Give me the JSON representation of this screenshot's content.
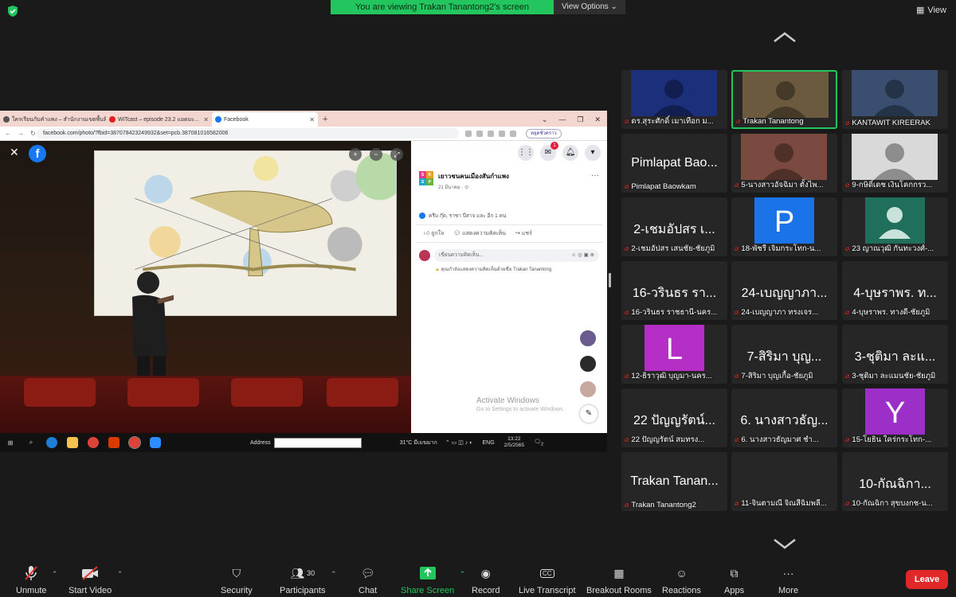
{
  "banner": {
    "viewing": "You are viewing Trakan Tanantong2's screen",
    "view_options": "View Options ⌄",
    "view": "View"
  },
  "browser": {
    "tabs": [
      {
        "title": "ใครเรียนกับคำแพง – สำนักงานเขตพื้นที่...",
        "color": "#555"
      },
      {
        "title": "WiTcast – episode 23.2 แอดมะ...",
        "color": "#e02020"
      },
      {
        "title": "Facebook",
        "color": "#1877f2"
      }
    ],
    "url": "facebook.com/photo/?fbid=387078423249932&set=pcb.387081016582006",
    "profile_chip": "หยุดชั่วคราว"
  },
  "facebook": {
    "page_name": "เยาวชนคนเมืองสันกำแพง",
    "avatar_letters": [
      "S",
      "K",
      "S",
      "P"
    ],
    "date": "21 มีนาคม · ⊙",
    "reactions": "ครีม กุ๊ด, ราชา ปีสาจ และ อีก 1 คน",
    "like": "ถูกใจ",
    "comment": "แสดงความคิดเห็น",
    "share": "แชร์",
    "comment_placeholder": "เขียนความคิดเห็น...",
    "warning": "คุณกำลังแสดงความคิดเห็นด้วยชื่อ Trakan Tanantong",
    "activate_title": "Activate Windows",
    "activate_sub": "Go to Settings to activate Windows.",
    "messenger_badge": "1"
  },
  "taskbar": {
    "address_label": "Address",
    "weather": "31°C มีเมฆมาก",
    "lang": "ENG",
    "time": "13:22",
    "date": "2/5/2565",
    "notify": "2"
  },
  "gallery": [
    {
      "big": "",
      "cap": "ดร.สุระศักดิ์ เมาเทือก ม...",
      "type": "video",
      "bg": "#1c2f7a"
    },
    {
      "big": "",
      "cap": "Trakan Tanantong",
      "type": "video",
      "bg": "#6b5a3e",
      "speaking": true
    },
    {
      "big": "",
      "cap": "KANTAWIT KIREERAK",
      "type": "video",
      "bg": "#3a4f70"
    },
    {
      "big": "Pimlapat Bao...",
      "cap": "Pimlapat Baowkam",
      "type": "name"
    },
    {
      "big": "",
      "cap": "5-นางสาวอัจฉิมา ตั้งไพ...",
      "type": "video",
      "bg": "#7a4a40"
    },
    {
      "big": "",
      "cap": "9-กษิดิ์เดช เงินโคกกรว...",
      "type": "video",
      "bg": "#d9d9d9"
    },
    {
      "big": "2-เชมอัปสร เ...",
      "cap": "2-เชมอัปสร เสนชัย-ชัยภูมิ",
      "type": "name"
    },
    {
      "big": "P",
      "cap": "18-พัชรี เจิมกระโทก-น...",
      "type": "letter",
      "bg": "#1a73e8"
    },
    {
      "big": "",
      "cap": "23 ญาณวุฒิ กันทะวงศ์-...",
      "type": "avatar",
      "bg": "#1f6f5c"
    },
    {
      "big": "16-วรินธร รา...",
      "cap": "16-วรินธร ราชธานี-นคร...",
      "type": "name"
    },
    {
      "big": "24-เบญญาภา...",
      "cap": "24-เบญญาภา ทรงเจร...",
      "type": "name"
    },
    {
      "big": "4-บุษราพร. ท...",
      "cap": "4-บุษราพร. ทางดี-ชัยภูมิ",
      "type": "name"
    },
    {
      "big": "L",
      "cap": "12-ธิราวุฒิ บุญมา-นคร...",
      "type": "letter",
      "bg": "#b52fc7"
    },
    {
      "big": "7-สิริมา บุญ...",
      "cap": "7-สิริมา บุญเกื้อ-ชัยภูมิ",
      "type": "name"
    },
    {
      "big": "3-ชุติมา ละแ...",
      "cap": "3-ชุติมา ละแมนชัย-ชัยภูมิ",
      "type": "name"
    },
    {
      "big": "22 ปัญญรัตน์...",
      "cap": "22 ปัญญรัตน์ สมทรง...",
      "type": "name"
    },
    {
      "big": "6. นางสาวธัญ...",
      "cap": "6. นางสาวธัญมาศ ชำ...",
      "type": "name"
    },
    {
      "big": "Y",
      "cap": "15-โยธิน ใคร่กระโทก-...",
      "type": "letter",
      "bg": "#9b2fc7"
    },
    {
      "big": "Trakan Tanan...",
      "cap": "Trakan Tanantong2",
      "type": "name"
    },
    {
      "big": "",
      "cap": "11-จินตามณี จิณสีฉิมพลี...",
      "type": "name"
    },
    {
      "big": "10-กัณฉิกา...",
      "cap": "10-กัณฉิกา สุขบงกช-น...",
      "type": "name"
    }
  ],
  "toolbar": {
    "unmute": "Unmute",
    "start_video": "Start Video",
    "security": "Security",
    "participants": "Participants",
    "participants_count": "30",
    "chat": "Chat",
    "share_screen": "Share Screen",
    "record": "Record",
    "live_transcript": "Live Transcript",
    "breakout": "Breakout Rooms",
    "reactions": "Reactions",
    "apps": "Apps",
    "more": "More",
    "leave": "Leave"
  }
}
